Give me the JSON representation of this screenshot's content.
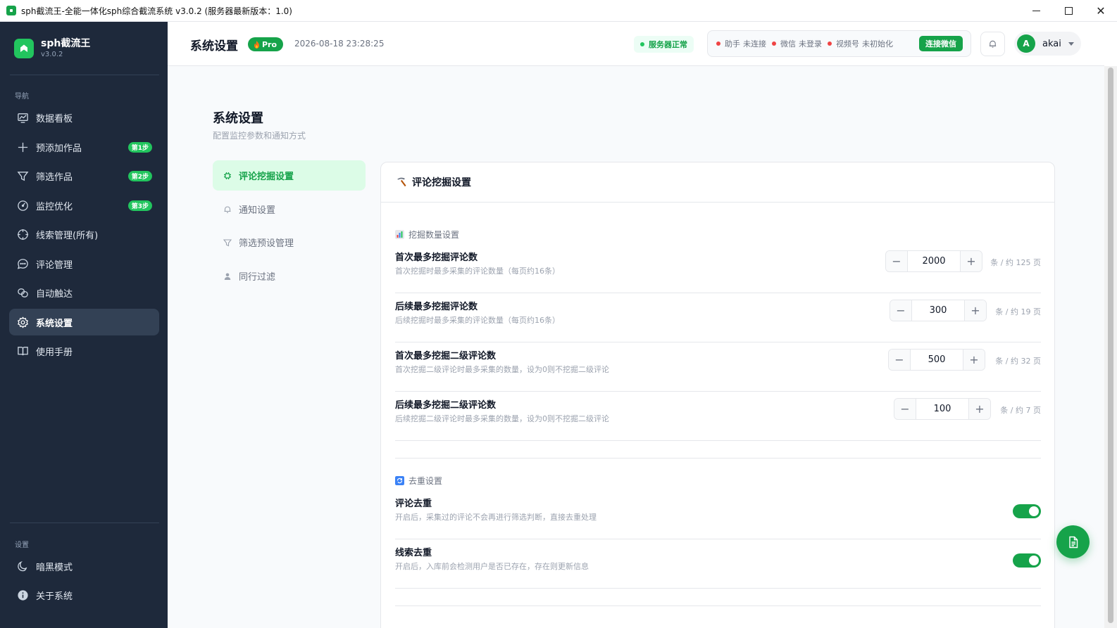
{
  "window": {
    "title": "sph截流王-全能一体化sph综合截流系统 v3.0.2 (服务器最新版本：1.0)"
  },
  "brand": {
    "name": "sph截流王",
    "version": "v3.0.2"
  },
  "sidebar": {
    "nav_section": "导航",
    "items": [
      {
        "label": "数据看板",
        "icon": "dashboard-icon"
      },
      {
        "label": "预添加作品",
        "icon": "plus-icon",
        "badge": "第1步"
      },
      {
        "label": "筛选作品",
        "icon": "filter-icon",
        "badge": "第2步"
      },
      {
        "label": "监控优化",
        "icon": "gauge-icon",
        "badge": "第3步"
      },
      {
        "label": "线索管理(所有)",
        "icon": "crosshair-icon"
      },
      {
        "label": "评论管理",
        "icon": "chat-icon"
      },
      {
        "label": "自动触达",
        "icon": "link-icon"
      },
      {
        "label": "系统设置",
        "icon": "gear-icon",
        "active": true
      },
      {
        "label": "使用手册",
        "icon": "book-icon"
      }
    ],
    "settings_section": "设置",
    "bottom_items": [
      {
        "label": "暗黑模式",
        "icon": "moon-icon"
      },
      {
        "label": "关于系统",
        "icon": "info-icon"
      }
    ]
  },
  "header": {
    "title": "系统设置",
    "pro_label": "Pro",
    "datetime": "2026-08-18 23:28:25",
    "server_status": "服务器正常",
    "statuses": [
      {
        "name": "助手",
        "state": "未连接"
      },
      {
        "name": "微信",
        "state": "未登录"
      },
      {
        "name": "视频号",
        "state": "未初始化"
      }
    ],
    "connect_label": "连接微信",
    "user": {
      "initial": "A",
      "name": "akai"
    }
  },
  "page": {
    "title": "系统设置",
    "subtitle": "配置监控参数和通知方式",
    "subnav": [
      {
        "label": "评论挖掘设置",
        "active": true
      },
      {
        "label": "通知设置"
      },
      {
        "label": "筛选预设管理"
      },
      {
        "label": "同行过滤"
      }
    ]
  },
  "card": {
    "title": "评论挖掘设置",
    "section1_label": "挖掘数量设置",
    "rows": [
      {
        "title": "首次最多挖掘评论数",
        "desc": "首次挖掘时最多采集的评论数量（每页约16条）",
        "value": "2000",
        "unit": "条 / 约 125 页"
      },
      {
        "title": "后续最多挖掘评论数",
        "desc": "后续挖掘时最多采集的评论数量（每页约16条）",
        "value": "300",
        "unit": "条 / 约 19 页"
      },
      {
        "title": "首次最多挖掘二级评论数",
        "desc": "首次挖掘二级评论时最多采集的数量，设为0则不挖掘二级评论",
        "value": "500",
        "unit": "条 / 约 32 页"
      },
      {
        "title": "后续最多挖掘二级评论数",
        "desc": "后续挖掘二级评论时最多采集的数量，设为0则不挖掘二级评论",
        "value": "100",
        "unit": "条 / 约 7 页"
      }
    ],
    "section2_label": "去重设置",
    "toggles": [
      {
        "title": "评论去重",
        "desc": "开启后，采集过的评论不会再进行筛选判断，直接去重处理",
        "on": true
      },
      {
        "title": "线索去重",
        "desc": "开启后，入库前会检测用户是否已存在，存在则更新信息",
        "on": true
      }
    ]
  },
  "colors": {
    "accent": "#16a34a",
    "sidebar_bg": "#1e293b",
    "danger": "#ef4444"
  }
}
